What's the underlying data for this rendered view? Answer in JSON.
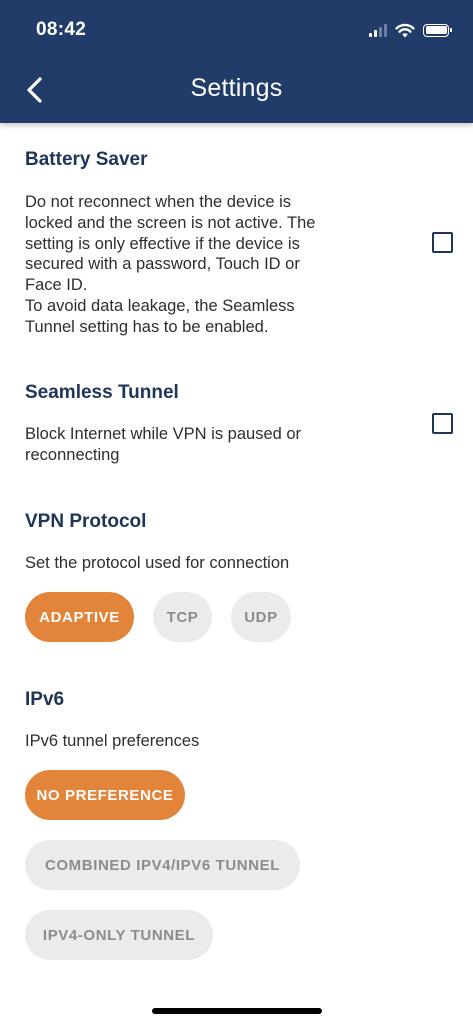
{
  "status_bar": {
    "time": "08:42"
  },
  "header": {
    "title": "Settings",
    "back_icon": "chevron-left-icon"
  },
  "colors": {
    "header_bg": "#223c6a",
    "accent": "#e2843a",
    "heading": "#1f3459",
    "pill_inactive_bg": "#ebebeb"
  },
  "battery_saver": {
    "title": "Battery Saver",
    "lines": [
      "Do not reconnect when the device is",
      "locked and the screen is not active. The",
      "setting is only effective if the device is",
      "secured with a password, Touch ID or",
      "Face ID.",
      "To avoid data leakage, the Seamless",
      "Tunnel setting has to be enabled."
    ],
    "checked": false
  },
  "seamless_tunnel": {
    "title": "Seamless Tunnel",
    "lines": [
      "Block Internet while VPN is paused or",
      "reconnecting"
    ],
    "checked": false
  },
  "vpn_protocol": {
    "title": "VPN Protocol",
    "description": "Set the protocol used for connection",
    "options": [
      "ADAPTIVE",
      "TCP",
      "UDP"
    ],
    "selected": "ADAPTIVE"
  },
  "ipv6": {
    "title": "IPv6",
    "description": "IPv6 tunnel preferences",
    "options": [
      "NO PREFERENCE",
      "COMBINED IPV4/IPV6 TUNNEL",
      "IPV4-ONLY TUNNEL"
    ],
    "selected": "NO PREFERENCE"
  }
}
